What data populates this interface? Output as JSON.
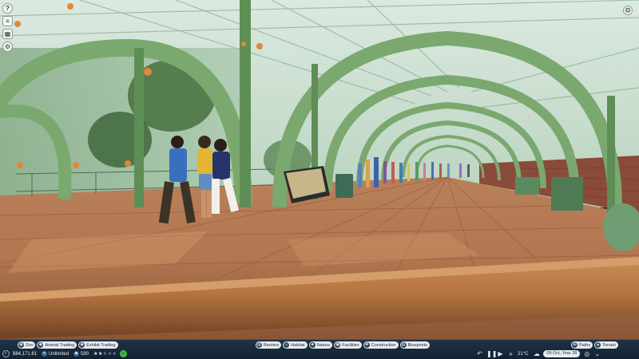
{
  "left_tools": {
    "items": [
      {
        "name": "help-icon",
        "glyph": "?"
      },
      {
        "name": "objectives-icon",
        "glyph": "≡"
      },
      {
        "name": "calendar-icon",
        "glyph": "▦"
      },
      {
        "name": "zoo-manager-icon",
        "glyph": "⚙"
      }
    ]
  },
  "settings": {
    "glyph": "⚙"
  },
  "hud": {
    "left_tabs": [
      {
        "name": "zoo-button",
        "label": "Zoo",
        "icon": "◉"
      },
      {
        "name": "animal-trading-button",
        "label": "Animal Trading",
        "icon": "◉"
      },
      {
        "name": "exhibit-trading-button",
        "label": "Exhibit Trading",
        "icon": "◉"
      }
    ],
    "money": "$84,171.81",
    "research": "Unlimited",
    "guests": "590",
    "rating": {
      "filled": 2,
      "total": 5
    },
    "build_tabs": [
      {
        "name": "barriers-button",
        "label": "Barriers"
      },
      {
        "name": "habitat-button",
        "label": "Habitat"
      },
      {
        "name": "nature-button",
        "label": "Nature"
      },
      {
        "name": "facilities-button",
        "label": "Facilities"
      },
      {
        "name": "construction-button",
        "label": "Construction"
      },
      {
        "name": "blueprints-button",
        "label": "Blueprints"
      }
    ],
    "temperature": "21°C",
    "date": "09 Oct, Year 28",
    "right_tabs": [
      {
        "name": "paths-button",
        "label": "Paths"
      },
      {
        "name": "terrain-button",
        "label": "Terrain"
      }
    ]
  }
}
